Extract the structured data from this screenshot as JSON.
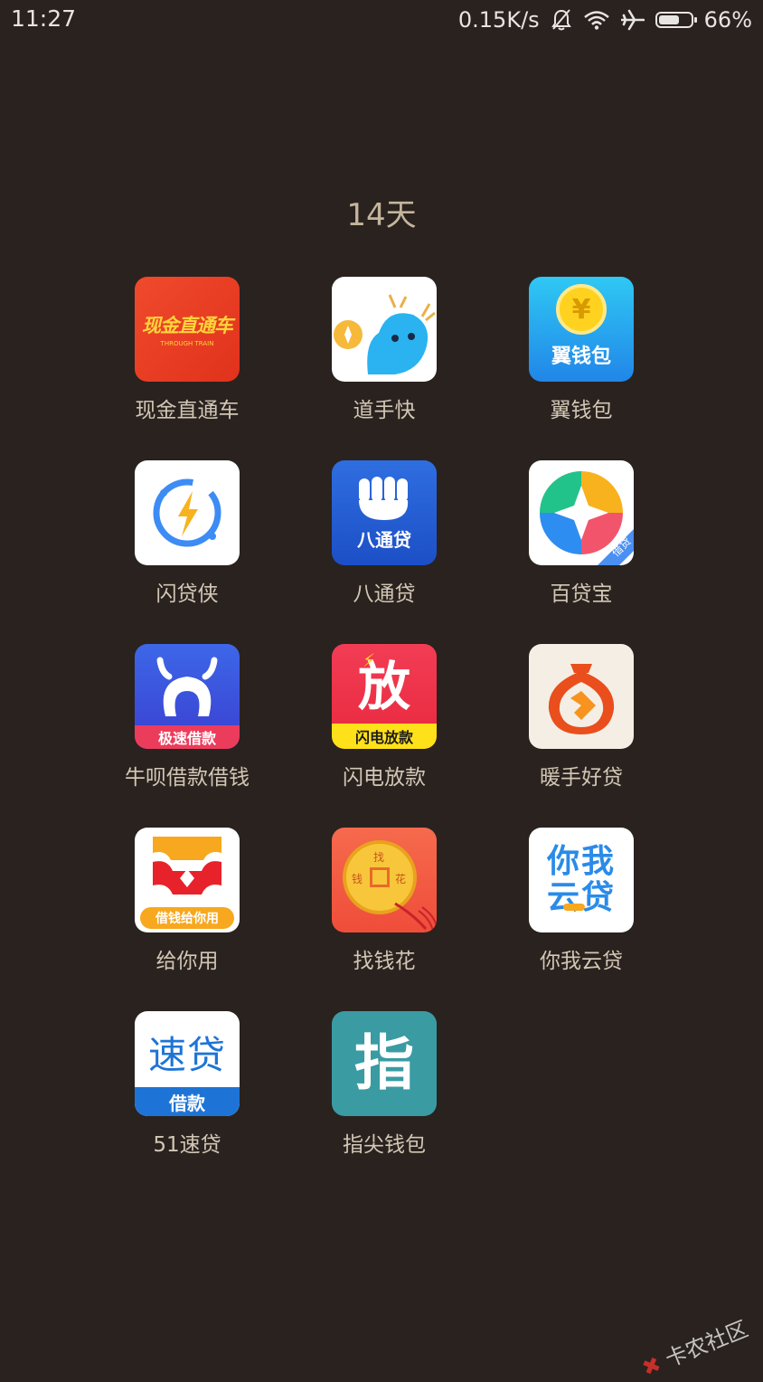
{
  "status_bar": {
    "time": "11:27",
    "net_speed": "0.15K/s",
    "battery_percent": "66%",
    "battery_level": 0.66,
    "icons": [
      "mute-bell-icon",
      "wifi-icon",
      "airplane-icon",
      "battery-icon"
    ]
  },
  "folder": {
    "title": "14天"
  },
  "apps": [
    {
      "label": "现金直通车",
      "icon": "xianjin-zhitongche-icon",
      "icon_text": "现金直通车",
      "icon_subtext": "THROUGH TRAIN"
    },
    {
      "label": "道手快",
      "icon": "daoshoukuai-icon"
    },
    {
      "label": "翼钱包",
      "icon": "yiqianbao-icon",
      "icon_text": "翼钱包",
      "icon_symbol": "¥"
    },
    {
      "label": "闪贷侠",
      "icon": "shandaixia-icon"
    },
    {
      "label": "八通贷",
      "icon": "batongdai-icon",
      "icon_text": "八通贷"
    },
    {
      "label": "百贷宝",
      "icon": "baidaibao-icon",
      "icon_badge": "借贷"
    },
    {
      "label": "牛呗借款借钱",
      "icon": "niubei-icon",
      "icon_text": "极速借款"
    },
    {
      "label": "闪电放款",
      "icon": "shandian-fangkuan-icon",
      "icon_glyph": "放",
      "icon_text": "闪电放款"
    },
    {
      "label": "暖手好贷",
      "icon": "nuanshou-haodai-icon"
    },
    {
      "label": "给你用",
      "icon": "geiniyong-icon",
      "icon_text": "借钱给你用"
    },
    {
      "label": "找钱花",
      "icon": "zhaoqianhua-icon",
      "icon_coin_chars": [
        "找",
        "钱",
        "花"
      ]
    },
    {
      "label": "你我云贷",
      "icon": "niwo-yundai-icon",
      "icon_line1": "你我",
      "icon_line2": "云贷"
    },
    {
      "label": "51速贷",
      "icon": "sudai-icon",
      "icon_text": "速贷",
      "icon_subtext": "借款"
    },
    {
      "label": "指尖钱包",
      "icon": "zhijian-qianbao-icon",
      "icon_glyph": "指"
    }
  ],
  "watermark": {
    "text": "卡农社区",
    "icon": "kanong-logo-icon"
  },
  "colors": {
    "background": "#2a221f",
    "folder_title": "#c4b69c",
    "app_label": "#d2c7b5"
  }
}
